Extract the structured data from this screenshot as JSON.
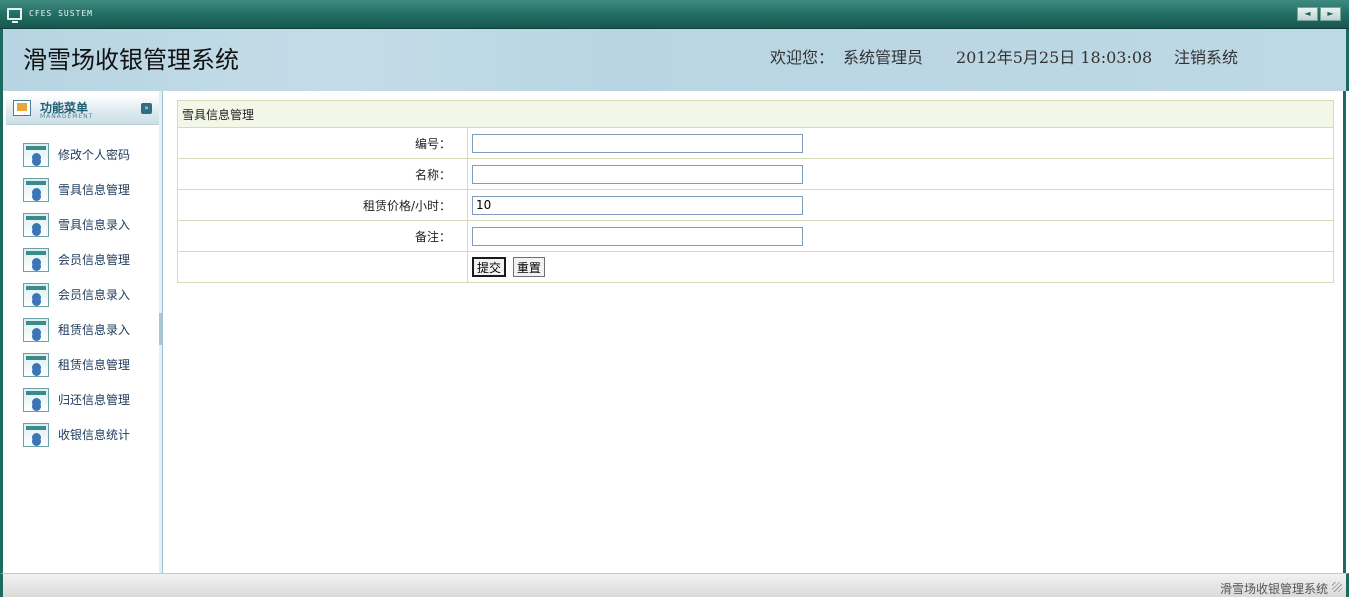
{
  "topbar": {
    "system_name": "CFES SUSTEM",
    "nav_prev": "◄",
    "nav_next": "►"
  },
  "header": {
    "app_title": "滑雪场收银管理系统",
    "welcome_label": "欢迎您：",
    "user_name": "系统管理员",
    "datetime": "2012年5月25日 18:03:08",
    "logout_label": "注销系统"
  },
  "sidebar": {
    "menu_title": "功能菜单",
    "menu_subtitle": "MANAGEMENT",
    "collapse_glyph": "»",
    "items": [
      {
        "label": "修改个人密码",
        "icon": "user-card-icon"
      },
      {
        "label": "雪具信息管理",
        "icon": "user-card-icon"
      },
      {
        "label": "雪具信息录入",
        "icon": "user-card-icon"
      },
      {
        "label": "会员信息管理",
        "icon": "user-card-icon"
      },
      {
        "label": "会员信息录入",
        "icon": "user-card-icon"
      },
      {
        "label": "租赁信息录入",
        "icon": "user-card-icon"
      },
      {
        "label": "租赁信息管理",
        "icon": "user-card-icon"
      },
      {
        "label": "归还信息管理",
        "icon": "user-card-icon"
      },
      {
        "label": "收银信息统计",
        "icon": "user-card-icon"
      }
    ]
  },
  "form": {
    "caption": "雪具信息管理",
    "fields": [
      {
        "label": "编号：",
        "value": ""
      },
      {
        "label": "名称：",
        "value": ""
      },
      {
        "label": "租赁价格/小时：",
        "value": "10"
      },
      {
        "label": "备注：",
        "value": ""
      }
    ],
    "submit_label": "提交",
    "reset_label": "重置"
  },
  "footer": {
    "text": "滑雪场收银管理系统"
  },
  "colors": {
    "frame": "#1f6a60",
    "header_bg": "#bed8e5",
    "table_border": "#d7dcb8"
  }
}
